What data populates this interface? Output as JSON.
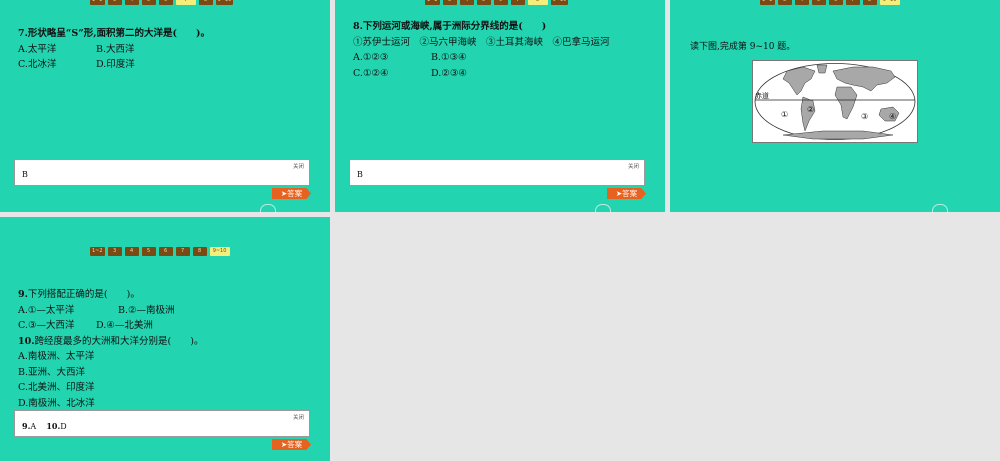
{
  "nav": {
    "items": [
      "1~2",
      "3",
      "4",
      "5",
      "6",
      "7",
      "8",
      "9~10"
    ]
  },
  "slide1": {
    "question": "7.形状略呈“S”形,面积第二的大洋是(　　)。",
    "opt_a": "A.太平洋",
    "opt_b": "B.大西洋",
    "opt_c": "C.北冰洋",
    "opt_d": "D.印度洋",
    "close": "关闭",
    "answer": "B",
    "answer_btn": "➤答案"
  },
  "slide2": {
    "question": "8.下列运河或海峡,属于洲际分界线的是(　　)",
    "options_line": "①苏伊士运河　②马六甲海峡　③土耳其海峡　④巴拿马运河",
    "opt_a": "A.①②③",
    "opt_b": "B.①③④",
    "opt_c": "C.①②④",
    "opt_d": "D.②③④",
    "close": "关闭",
    "answer": "B",
    "answer_btn": "➤答案"
  },
  "slide3": {
    "intro": "读下图,完成第 9~10 题。",
    "map_equator": "赤道",
    "map_m1": "①",
    "map_m2": "②",
    "map_m3": "③",
    "map_m4": "④"
  },
  "slide4": {
    "q9_num": "9.",
    "q9": "下列搭配正确的是(　　)。",
    "q9_a": "A.①—太平洋",
    "q9_b": "B.②—南极洲",
    "q9_c": "C.③—大西洋",
    "q9_d": "D.④—北美洲",
    "q10_num": "10.",
    "q10": "跨经度最多的大洲和大洋分别是(　　)。",
    "q10_a": "A.南极洲、太平洋",
    "q10_b": "B.亚洲、大西洋",
    "q10_c": "C.北美洲、印度洋",
    "q10_d": "D.南极洲、北冰洋",
    "close": "关闭",
    "answer_9_num": "9.",
    "answer_9": "A",
    "answer_10_num": "10.",
    "answer_10": "D",
    "answer_btn": "➤答案"
  },
  "colors": {
    "slide_bg": "#22d4b0",
    "nav_bg": "#7a4a14",
    "nav_active": "#f3ef7a",
    "answer_btn": "#e8621f"
  }
}
